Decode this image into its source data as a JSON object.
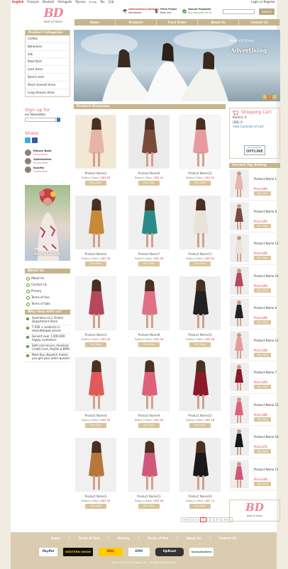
{
  "header": {
    "languages": [
      "English",
      "Français",
      "Deutsch",
      "Português",
      "Pусско",
      "עברית",
      "Tes",
      "日本"
    ],
    "login": "Login",
    "or": "or",
    "register": "Register",
    "logo_mark": "BD",
    "logo_tag": "best of dress",
    "badge1_title": "International Delivery",
    "badge1_sub": "Worldwide",
    "badge2_title": "Price Promi",
    "badge2_sub": "Best info",
    "badge3_title": "Secure Payment",
    "badge3_sub": "Buy Securely Wi To",
    "search_placeholder": "",
    "search_button": "Search"
  },
  "nav": [
    "Home",
    "Products",
    "Track Order",
    "About Us",
    "Contact Us"
  ],
  "categories": {
    "title": "Product Categories",
    "items": [
      "Chiffon",
      "Bohemian",
      "Silk",
      "Plaid Skirt",
      "Lace dress",
      "Denim skirt",
      "Short sleeved dress",
      "Long sleeves dress"
    ]
  },
  "banner": {
    "line1": "Best Of Dress",
    "line2": "Advertising",
    "pages": [
      "1",
      "2",
      "3"
    ]
  },
  "signup": {
    "title": "Sign up for",
    "sub": "our Newsletter"
  },
  "share": {
    "title": "Share:"
  },
  "badges": [
    {
      "title": "Money Back",
      "sub": "Guarantee"
    },
    {
      "title": "Satisfaction",
      "sub": "Guarantee"
    },
    {
      "title": "Quality",
      "sub": "Guarantee"
    }
  ],
  "sidead": {
    "line1": "Best Of Dress",
    "line2": "Advertising"
  },
  "about": {
    "title": "About Us",
    "items": [
      "About Us",
      "Contact Us",
      "Privacy",
      "Terms of Use",
      "Terms of Sale"
    ]
  },
  "why": {
    "title": "Why shop with us?",
    "items": [
      "Australias no.1 Online Department Store",
      "7,500 + products in stock(Bargain prices",
      "Servert over 1,000,000 happy customers",
      "Safe and secure checkout Credit Card, PayPal & BPAY",
      "Next-day dispatch means you get your order quicker"
    ]
  },
  "showcase": {
    "title": "Product Showcase"
  },
  "products": [
    {
      "name": "Product Name1",
      "deal": "Today's Deal:",
      "price": "USD 69",
      "btn": "Buy Now"
    },
    {
      "name": "Product Name6",
      "deal": "Today's Deal:",
      "price": "USD 45",
      "btn": "Buy Now"
    },
    {
      "name": "Product Name12",
      "deal": "Today's Deal:",
      "price": "USD 50",
      "btn": "Buy Now"
    },
    {
      "name": "Product Name2",
      "deal": "Today's Deal:",
      "price": "USD 58",
      "btn": "Buy Now"
    },
    {
      "name": "Product Name7",
      "deal": "Today's Deal:",
      "price": "USD 56",
      "btn": "Buy Now"
    },
    {
      "name": "Product Name13",
      "deal": "Today's Deal:",
      "price": "USD 65",
      "btn": "Buy Now"
    },
    {
      "name": "Product Name3",
      "deal": "Today's Deal:",
      "price": "USD 58",
      "btn": "Buy Now"
    },
    {
      "name": "Product Name8",
      "deal": "Today's Deal:",
      "price": "USD 56",
      "btn": "Buy Now"
    },
    {
      "name": "Product Name14",
      "deal": "Today's Deal:",
      "price": "USD 56",
      "btn": "Buy Now"
    },
    {
      "name": "Product Name4",
      "deal": "Today's Deal:",
      "price": "USD 58",
      "btn": "Buy Now"
    },
    {
      "name": "Product Name9",
      "deal": "Today's Deal:",
      "price": "USD 48",
      "btn": "Buy Now"
    },
    {
      "name": "Product Name15",
      "deal": "Today's Deal:",
      "price": "USD 56",
      "btn": "Buy Now"
    },
    {
      "name": "Product Name5",
      "deal": "Today's Deal:",
      "price": "USD 58",
      "btn": "Buy Now"
    },
    {
      "name": "Product Name11",
      "deal": "Today's Deal:",
      "price": "USD 48",
      "btn": "Buy Now"
    },
    {
      "name": "Product Name16",
      "deal": "Today's Deal:",
      "price": "USD 74",
      "btn": "Buy Now"
    }
  ],
  "pagination": [
    "<<<",
    "<",
    "1",
    "2",
    ">",
    ">>>"
  ],
  "cart": {
    "title": "Shopping Cart",
    "items": "Item(s): 0",
    "usd": "USD: 0",
    "view": "View Contents of Cart",
    "support1": "Live Support",
    "support2": "OFFLINE"
  },
  "sellers": {
    "title": "Current Top Selling",
    "items": [
      {
        "name": "Product Name 1",
        "price": "Price:$69",
        "btn": "Buy Now"
      },
      {
        "name": "Product Name 6",
        "price": "Price:$59",
        "btn": "Buy Now"
      },
      {
        "name": "Product Name 12",
        "price": "Price:$58",
        "btn": "Buy Now"
      },
      {
        "name": "Product Name 14",
        "price": "Price:$56",
        "btn": "Buy Now"
      },
      {
        "name": "Product Name 9",
        "price": "Price:$48",
        "btn": "Buy Now"
      },
      {
        "name": "Product Name 12",
        "price": "Price:$58",
        "btn": "Buy Now"
      },
      {
        "name": "Product Name 7",
        "price": "Price:$56",
        "btn": "Buy Now"
      },
      {
        "name": "Product Name 15",
        "price": "Price:$48",
        "btn": "Buy Now"
      },
      {
        "name": "Product Name 16",
        "price": "Price:$74",
        "btn": "Buy Now"
      },
      {
        "name": "Product Name 11",
        "price": "Price:$48",
        "btn": "Buy Now"
      }
    ]
  },
  "footer": {
    "links": [
      "Home",
      "Terms of Sale",
      "Privacy",
      "Terms of Use",
      "About Us",
      "Contact Us"
    ],
    "payments": [
      "PayPal",
      "WESTERN UNION",
      "DHL",
      "EMS",
      "UpRoot",
      "moneybookers"
    ],
    "copyright": "Slnm 2013 Ecoi Group, Inc. All Rights Reserved."
  },
  "colors": {
    "accent": "#c6b48c",
    "pink": "#e0607a",
    "price": "#dd3333"
  }
}
